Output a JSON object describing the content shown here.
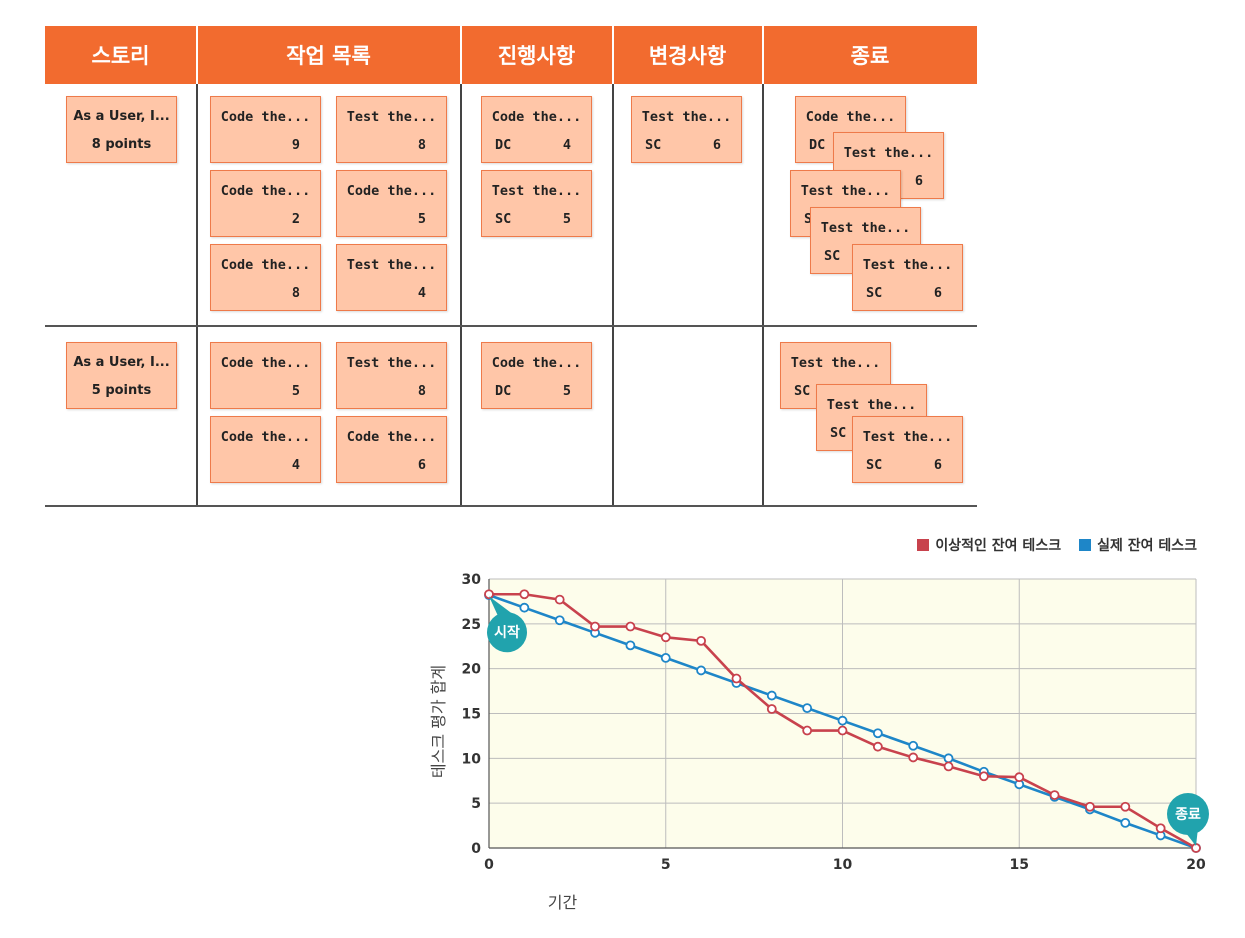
{
  "board": {
    "columns": [
      "스토리",
      "작업 목록",
      "진행사항",
      "변경사항",
      "종료"
    ],
    "rows": [
      {
        "story": {
          "title": "As a User, I...",
          "points": "8 points"
        },
        "todo": [
          {
            "title": "Code the...",
            "left": "",
            "right": "9"
          },
          {
            "title": "Test the...",
            "left": "",
            "right": "8"
          },
          {
            "title": "Code the...",
            "left": "",
            "right": "2"
          },
          {
            "title": "Code the...",
            "left": "",
            "right": "5"
          },
          {
            "title": "Code the...",
            "left": "",
            "right": "8"
          },
          {
            "title": "Test the...",
            "left": "",
            "right": "4"
          }
        ],
        "in_progress": [
          {
            "title": "Code the...",
            "left": "DC",
            "right": "4"
          },
          {
            "title": "Test the...",
            "left": "SC",
            "right": "5"
          }
        ],
        "changes": [
          {
            "title": "Test the...",
            "left": "SC",
            "right": "6"
          }
        ],
        "done": [
          {
            "title": "Code the...",
            "left": "DC",
            "right": ""
          },
          {
            "title": "Test the...",
            "left": "",
            "right": "6"
          },
          {
            "title": "Test the...",
            "left": "S",
            "right": ""
          },
          {
            "title": "Test the...",
            "left": "SC",
            "right": ""
          },
          {
            "title": "Test the...",
            "left": "SC",
            "right": "6"
          }
        ]
      },
      {
        "story": {
          "title": "As a User, I...",
          "points": "5 points"
        },
        "todo": [
          {
            "title": "Code the...",
            "left": "",
            "right": "5"
          },
          {
            "title": "Test the...",
            "left": "",
            "right": "8"
          },
          {
            "title": "Code the...",
            "left": "",
            "right": "4"
          },
          {
            "title": "Code the...",
            "left": "",
            "right": "6"
          }
        ],
        "in_progress": [
          {
            "title": "Code the...",
            "left": "DC",
            "right": "5"
          }
        ],
        "changes": [],
        "done": [
          {
            "title": "Test the...",
            "left": "SC",
            "right": ""
          },
          {
            "title": "Test the...",
            "left": "SC",
            "right": ""
          },
          {
            "title": "Test the...",
            "left": "SC",
            "right": "6"
          }
        ]
      }
    ]
  },
  "colors": {
    "header": "#F26B2F",
    "card_fill": "#FFC6A8",
    "card_border": "#EE7A4A",
    "ideal": "#C8424D",
    "actual": "#1E86C8",
    "plot_bg": "#FDFDEB",
    "marker": "#21A3AD"
  },
  "chart_data": {
    "type": "line",
    "xlabel": "기간",
    "ylabel": "테스크 평가 합계",
    "xlim": [
      0,
      20
    ],
    "ylim": [
      0,
      30
    ],
    "xticks": [
      0,
      5,
      10,
      15,
      20
    ],
    "yticks": [
      0,
      5,
      10,
      15,
      20,
      25,
      30
    ],
    "grid": true,
    "legend": "top-right",
    "series": [
      {
        "name": "이상적인 잔여 테스크",
        "color": "#C8424D",
        "x": [
          0,
          1,
          2,
          3,
          4,
          5,
          6,
          7,
          8,
          9,
          10,
          11,
          12,
          13,
          14,
          15,
          16,
          17,
          18,
          19,
          20
        ],
        "y": [
          28.3,
          28.3,
          27.7,
          24.7,
          24.7,
          23.5,
          23.1,
          18.9,
          15.5,
          13.1,
          13.1,
          11.3,
          10.1,
          9.1,
          8.0,
          7.9,
          5.9,
          4.6,
          4.6,
          2.2,
          0
        ]
      },
      {
        "name": "실제 잔여 테스크",
        "color": "#1E86C8",
        "x": [
          0,
          1,
          2,
          3,
          4,
          5,
          6,
          7,
          8,
          9,
          10,
          11,
          12,
          13,
          14,
          15,
          16,
          17,
          18,
          19,
          20
        ],
        "y": [
          28.2,
          26.8,
          25.4,
          24.0,
          22.6,
          21.2,
          19.8,
          18.4,
          17.0,
          15.6,
          14.2,
          12.8,
          11.4,
          10.0,
          8.5,
          7.1,
          5.7,
          4.3,
          2.8,
          1.4,
          0
        ]
      }
    ],
    "annotations": [
      {
        "text": "시작",
        "x": 0,
        "y": 28.3
      },
      {
        "text": "종료",
        "x": 20,
        "y": 0
      }
    ]
  }
}
